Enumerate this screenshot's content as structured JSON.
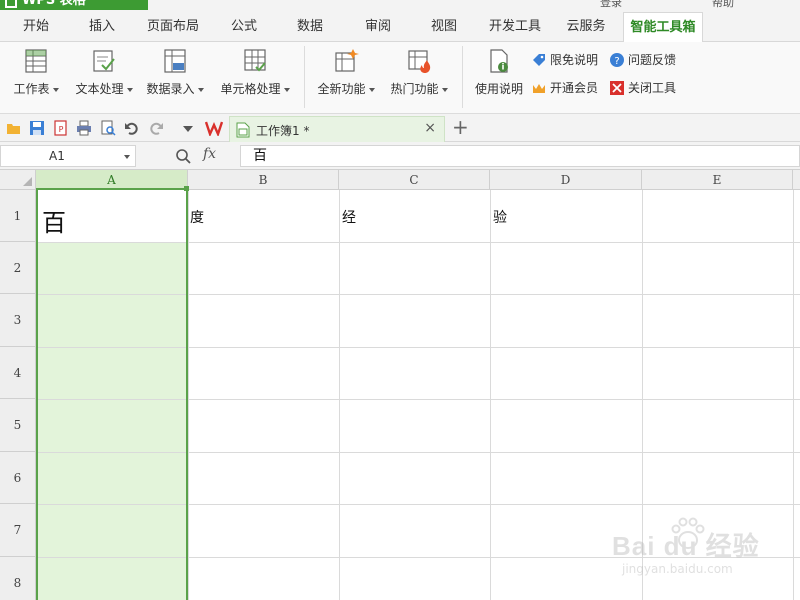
{
  "titlebar": {
    "app_name": "WPS 表格",
    "fragment_left": "登录",
    "fragment_right": "帮助"
  },
  "ribbon_tabs": [
    {
      "label": "开始",
      "active": false
    },
    {
      "label": "插入",
      "active": false
    },
    {
      "label": "页面布局",
      "active": false
    },
    {
      "label": "公式",
      "active": false
    },
    {
      "label": "数据",
      "active": false
    },
    {
      "label": "审阅",
      "active": false
    },
    {
      "label": "视图",
      "active": false
    },
    {
      "label": "开发工具",
      "active": false
    },
    {
      "label": "云服务",
      "active": false
    },
    {
      "label": "智能工具箱",
      "active": true
    }
  ],
  "ribbon": {
    "large_buttons": [
      {
        "label": "工作表",
        "icon": "worksheet-icon",
        "dropdown": true
      },
      {
        "label": "文本处理",
        "icon": "text-process-icon",
        "dropdown": true
      },
      {
        "label": "数据录入",
        "icon": "data-entry-icon",
        "dropdown": true
      },
      {
        "label": "单元格处理",
        "icon": "cell-process-icon",
        "dropdown": true
      },
      {
        "label": "全新功能",
        "icon": "new-features-icon",
        "dropdown": true
      },
      {
        "label": "热门功能",
        "icon": "hot-features-icon",
        "dropdown": true
      },
      {
        "label": "使用说明",
        "icon": "usage-guide-icon",
        "dropdown": false
      }
    ],
    "small_buttons": [
      {
        "label": "限免说明",
        "icon": "tag-icon"
      },
      {
        "label": "问题反馈",
        "icon": "question-icon"
      },
      {
        "label": "开通会员",
        "icon": "crown-icon"
      },
      {
        "label": "关闭工具",
        "icon": "close-tool-icon"
      }
    ]
  },
  "quick_access": {
    "icons": [
      "open-folder-icon",
      "save-icon",
      "pdf-export-icon",
      "print-icon",
      "print-preview-icon",
      "undo-icon",
      "redo-icon",
      "more-dropdown-icon"
    ]
  },
  "document_tab": {
    "name": "工作簿1 *",
    "close_symbol": "×",
    "new_tab_symbol": "+"
  },
  "formula_bar": {
    "name_box": "A1",
    "fx_label": "fx",
    "content": "百"
  },
  "sheet": {
    "column_headers": [
      "A",
      "B",
      "C",
      "D",
      "E"
    ],
    "row_headers": [
      "1",
      "2",
      "3",
      "4",
      "5",
      "6",
      "7",
      "8"
    ],
    "selected_column": "A",
    "active_cell": "A1",
    "cells": {
      "A1": "百",
      "B1": "度",
      "C1": "经",
      "D1": "验"
    }
  },
  "colors": {
    "accent_green": "#5aa24a",
    "selection_fill": "#e3f4da",
    "active_tab_text": "#2f8a26",
    "wps_red": "#d9302c"
  },
  "watermark": {
    "main": "Bai du 经验",
    "sub": "jingyan.baidu.com"
  }
}
